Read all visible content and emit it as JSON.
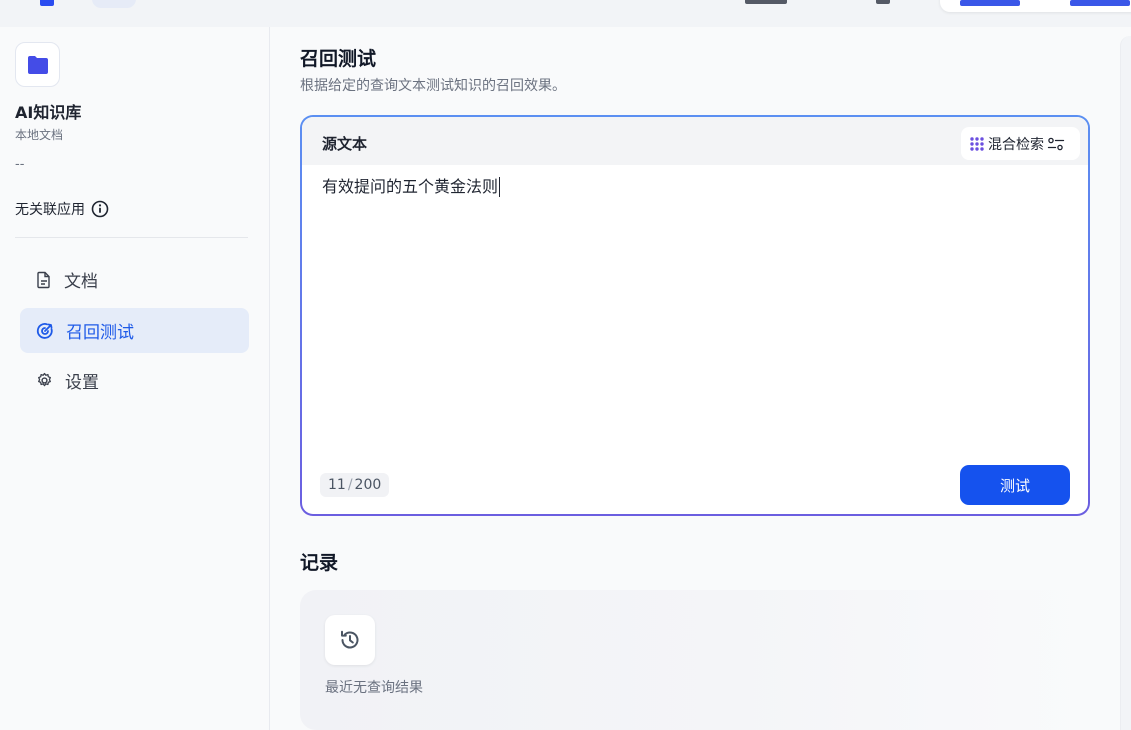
{
  "sidebar": {
    "kb_name": "AI知识库",
    "kb_type": "本地文档",
    "kb_desc": "--",
    "related_apps": "无关联应用",
    "items": [
      {
        "label": "文档",
        "icon": "document-icon",
        "active": false
      },
      {
        "label": "召回测试",
        "icon": "target-icon",
        "active": true
      },
      {
        "label": "设置",
        "icon": "gear-icon",
        "active": false
      }
    ]
  },
  "main": {
    "title": "召回测试",
    "subtitle": "根据给定的查询文本测试知识的召回效果。",
    "query": {
      "label": "源文本",
      "mode_label": "混合检索",
      "text": "有效提问的五个黄金法则",
      "count": "11",
      "max": "200",
      "submit_label": "测试"
    },
    "records": {
      "title": "记录",
      "empty_text": "最近无查询结果"
    }
  },
  "colors": {
    "accent": "#1552ee",
    "active_bg": "#e5ecf9",
    "border_gradient_start": "#5b8ff2",
    "border_gradient_end": "#6b5ee0"
  }
}
